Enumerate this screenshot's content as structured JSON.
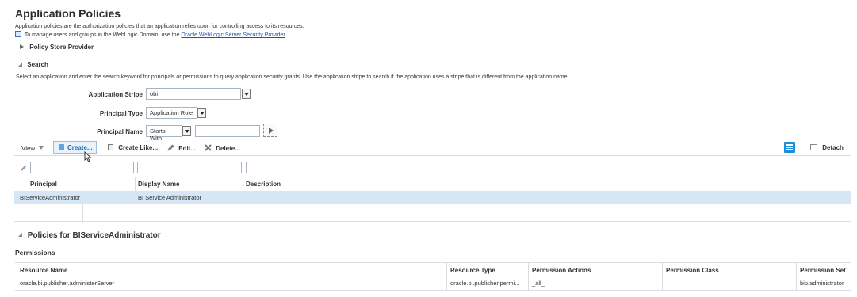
{
  "page": {
    "title": "Application Policies",
    "description": "Application policies are the authorization policies that an application relies upon for controlling access to its resources.",
    "manage_prefix": "To manage users and groups in the WebLogic Domain, use the",
    "manage_link": "Oracle WebLogic Server Security Provider",
    "manage_suffix": "."
  },
  "policy_store": {
    "label": "Policy Store Provider"
  },
  "search": {
    "header": "Search",
    "instructions": "Select an application and enter the search keyword for principals or permissions to query application security grants. Use the application stripe to search if the application uses a stripe that is different from the application name.",
    "stripe_label": "Application Stripe",
    "stripe_value": "obi",
    "principal_type_label": "Principal Type",
    "principal_type_value": "Application Role",
    "principal_name_label": "Principal Name",
    "principal_name_op": "Starts With",
    "principal_name_value": ""
  },
  "toolbar": {
    "view": "View",
    "create": "Create...",
    "create_like": "Create Like...",
    "edit": "Edit...",
    "delete": "Delete...",
    "detach": "Detach"
  },
  "grants_table": {
    "columns": [
      "Principal",
      "Display Name",
      "Description"
    ],
    "rows": [
      {
        "principal": "BIServiceAdministrator",
        "display_name": "BI Service Administrator",
        "description": ""
      }
    ]
  },
  "policies": {
    "header": "Policies for BIServiceAdministrator",
    "permissions_title": "Permissions",
    "columns": [
      "Resource Name",
      "Resource Type",
      "Permission Actions",
      "Permission Class",
      "Permission Set"
    ],
    "rows": [
      {
        "resource_name": "oracle.bi.publisher.administerServer",
        "resource_type": "oracle.bi.publisher.permi...",
        "actions": "_all_",
        "perm_class": "",
        "perm_set": "bip.administrator"
      }
    ]
  },
  "colors": {
    "selected_row": "#d6e6f5",
    "accent": "#1b8fd8"
  }
}
